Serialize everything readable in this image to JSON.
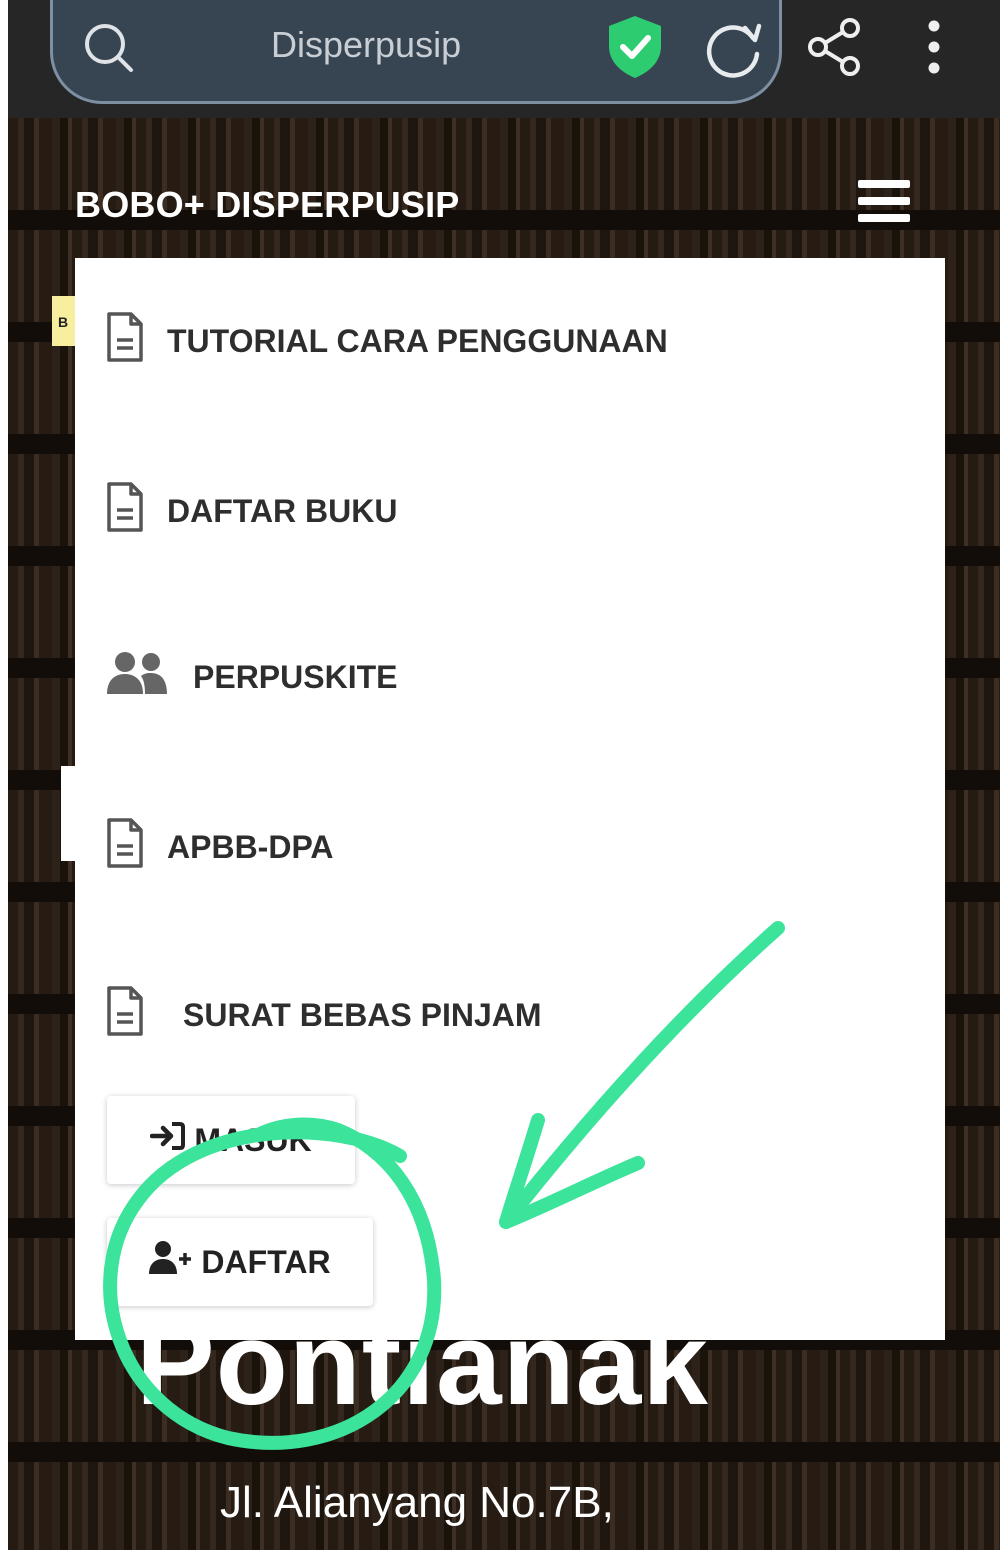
{
  "browser": {
    "url_text": "Disperpusip",
    "icons": [
      "search-icon",
      "shield-check-icon",
      "reload-icon",
      "share-icon",
      "more-vert-icon"
    ]
  },
  "site": {
    "brand": "BOBO+ DISPERPUSIP",
    "side_tag": "B",
    "hero_title": "Pontianak",
    "address": "Jl. Alianyang No.7B,"
  },
  "menu": {
    "items": [
      {
        "label": "TUTORIAL CARA PENGGUNAAN",
        "icon": "file-icon"
      },
      {
        "label": "DAFTAR BUKU",
        "icon": "file-icon"
      },
      {
        "label": "PERPUSKITE",
        "icon": "users-icon"
      },
      {
        "label": "APBB-DPA",
        "icon": "file-icon"
      },
      {
        "label": "SURAT BEBAS PINJAM",
        "icon": "file-icon"
      }
    ],
    "login_label": "MASUK",
    "register_label": "DAFTAR"
  },
  "colors": {
    "annotation": "#3be49a",
    "shield": "#2ecc71",
    "url_pill": "#374553"
  }
}
